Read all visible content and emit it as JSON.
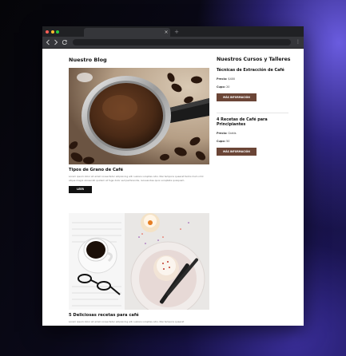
{
  "browser": {
    "tab_close_glyph": "×",
    "new_tab_glyph": "+",
    "menu_glyph": "⋮",
    "window_controls": {
      "close_color": "#ff5f57",
      "minimize_color": "#febc2e",
      "maximize_color": "#28c840"
    }
  },
  "blog": {
    "heading": "Nuestro Blog",
    "posts": [
      {
        "title": "Tipos de Grano de Café",
        "excerpt": "Lorem ipsum dolor sit amet consectetur adipisicing elit. Labore voluptas odio. Nisi tempora quaerat facilis illum nihil atque magni obcaecati quidem at fuga dolor sed perferendis, recusandae quos voluptate quisquam.",
        "button_label": "LEER ENTRADA",
        "image_icon": "coffee-portafilter-photo"
      },
      {
        "title": "5 Deliciosas recetas para café",
        "excerpt": "Lorem ipsum dolor sit amet consectetur adipisicing elit. Labore voluptas odio. Nisi tempora quaerat",
        "image_icon": "coffee-cup-cupcake-photo"
      }
    ]
  },
  "courses": {
    "heading": "Nuestros Cursos y Talleres",
    "items": [
      {
        "name": "Técnicas de Extracción de Café",
        "price_label": "Precio:",
        "price": "$400",
        "seats_label": "Cupo:",
        "seats": "20",
        "button_label": "MÁS INFORMACIÓN"
      },
      {
        "name": "4 Recetas de Café para Principiantes",
        "price_label": "Precio:",
        "price": "Gratis",
        "seats_label": "Cupo:",
        "seats": "50",
        "button_label": "MÁS INFORMACIÓN"
      }
    ]
  },
  "colors": {
    "accent_button": "#6b4536",
    "dark_button": "#111111"
  }
}
